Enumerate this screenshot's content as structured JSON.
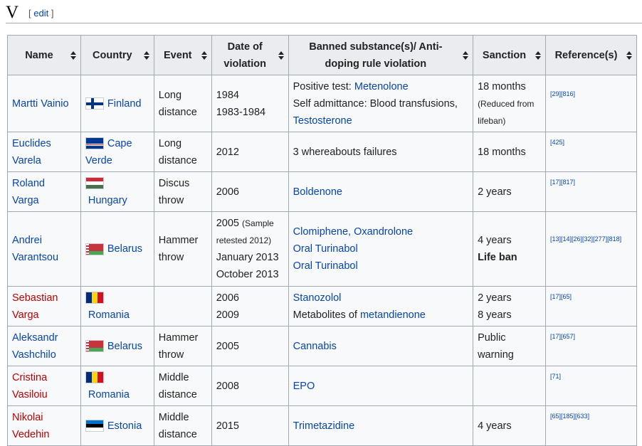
{
  "section": {
    "title": "V",
    "edit_open": "[ ",
    "edit_label": "edit",
    "edit_close": " ]"
  },
  "columns": [
    "Name",
    "Country",
    "Event",
    "Date of violation",
    "Banned substance(s)/ Anti-doping rule violation",
    "Sanction",
    "Reference(s)"
  ],
  "rows": [
    {
      "name": "Martti Vainio",
      "name_link": "blue",
      "country": "Finland",
      "flag": "fi-flag-icon",
      "event": [
        "Long",
        "distance"
      ],
      "date": [
        "1984",
        "1983-1984"
      ],
      "substance_line1_prefix": "Positive test: ",
      "substance_line1_link": "Metenolone",
      "substance_line2": "Self admittance: Blood transfusions,",
      "substance_line3_link": "Testosterone",
      "sanction": "18 months",
      "sanction_note": "(Reduced from lifeban)",
      "refs": [
        "[29]",
        "[816]"
      ]
    },
    {
      "name": "Euclides Varela",
      "country": "Cape Verde",
      "event": [
        "Long",
        "distance"
      ],
      "date": [
        "2012"
      ],
      "substance": "3 whereabouts failures",
      "sanction": "18 months",
      "refs": [
        "[425]"
      ]
    },
    {
      "name": "Roland Varga",
      "country": "Hungary",
      "event": [
        "Discus",
        "throw"
      ],
      "date": [
        "2006"
      ],
      "substance_link": "Boldenone",
      "sanction": "2 years",
      "refs": [
        "[17]",
        "[817]"
      ]
    },
    {
      "name": "Andrei Varantsou",
      "country": "Belarus",
      "event": [
        "Hammer",
        "throw"
      ],
      "date_line1": "2005",
      "date_note": "(Sample retested 2012)",
      "date_line2": "January 2013",
      "date_line3": "October 2013",
      "substance_line1_link": "Clomiphene, Oxandrolone",
      "substance_line2_link": "Oral Turinabol",
      "substance_line3_link": "Oral Turinabol",
      "sanction": "4 years",
      "sanction_bold": "Life ban",
      "refs": [
        "[13]",
        "[14]",
        "[26]",
        "[32]",
        "[277]",
        "[818]"
      ]
    },
    {
      "name": "Sebastian Varga",
      "country": "Romania",
      "event": [
        "",
        ""
      ],
      "date": [
        "2006",
        "2009"
      ],
      "substance_line1_link": "Stanozolol",
      "substance_line2_prefix": "Metabolites of ",
      "substance_line2_link": "metandienone",
      "sanction_line1": "2 years",
      "sanction_line2": "8 years",
      "refs": [
        "[17]",
        "[65]"
      ]
    },
    {
      "name": "Aleksandr Vashchilo",
      "country": "Belarus",
      "event": [
        "Hammer",
        "throw"
      ],
      "date": [
        "2005"
      ],
      "substance_link": "Cannabis",
      "sanction_line1": "Public",
      "sanction_line2": "warning",
      "refs": [
        "[17]",
        "[657]"
      ]
    },
    {
      "name": "Cristina Vasiloiu",
      "country": "Romania",
      "event": [
        "Middle",
        "distance"
      ],
      "date": [
        "2008"
      ],
      "substance_link": "EPO",
      "sanction": "",
      "refs": [
        "[71]"
      ]
    },
    {
      "name": "Nikolai Vedehin",
      "country": "Estonia",
      "event": [
        "Middle",
        "distance"
      ],
      "date": [
        "2015"
      ],
      "substance_link": "Trimetazidine",
      "sanction": "4 years",
      "refs": [
        "[65]",
        "[185]",
        "[633]"
      ]
    }
  ],
  "name_split": {
    "r0": [
      "Martti Vainio"
    ],
    "r1": [
      "Euclides",
      "Varela"
    ],
    "r2": [
      "Roland",
      "Varga"
    ],
    "r3": [
      "Andrei",
      "Varantsou"
    ],
    "r4": [
      "Sebastian",
      "Varga"
    ],
    "r5": [
      "Aleksandr",
      "Vashchilo"
    ],
    "r6": [
      "Cristina",
      "Vasiloiu"
    ],
    "r7": [
      "Nikolai",
      "Vedehin"
    ]
  },
  "country_split": {
    "r1": [
      "Cape",
      "Verde"
    ]
  },
  "colors": {
    "link": "#0645ad",
    "redlink": "#ba0000",
    "border": "#a2a9b1",
    "header_bg": "#eaecf0",
    "cell_bg": "#f8f9fa"
  }
}
